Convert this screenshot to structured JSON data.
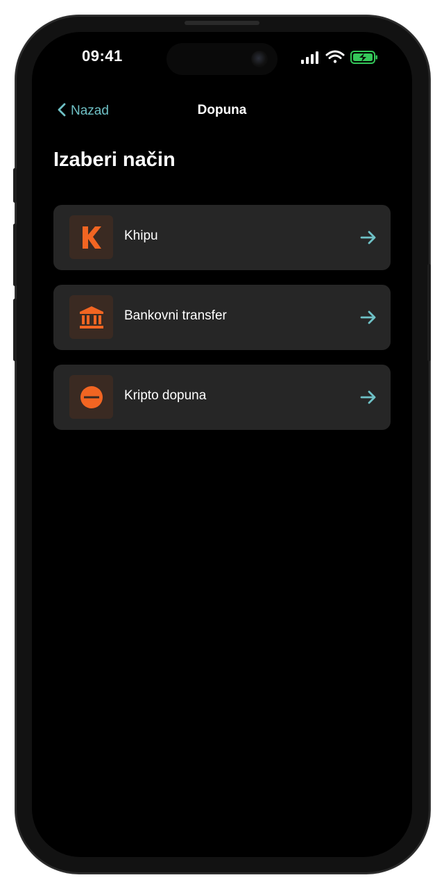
{
  "status_bar": {
    "time": "09:41",
    "signal_icon": "cellular-signal-icon",
    "wifi_icon": "wifi-icon",
    "battery_icon": "battery-charging-icon"
  },
  "nav": {
    "back_label": "Nazad",
    "back_icon": "chevron-left-icon",
    "title": "Dopuna"
  },
  "page": {
    "title": "Izaberi način"
  },
  "options": [
    {
      "label": "Khipu",
      "icon": "khipu-logo-icon",
      "arrow_icon": "arrow-right-icon"
    },
    {
      "label": "Bankovni transfer",
      "icon": "bank-icon",
      "arrow_icon": "arrow-right-icon"
    },
    {
      "label": "Kripto dopuna",
      "icon": "crypto-coin-icon",
      "arrow_icon": "arrow-right-icon"
    }
  ],
  "colors": {
    "accent": "#6fc1c6",
    "brand_orange": "#f26522",
    "card_bg": "#262626",
    "icon_bg": "#3a2a22",
    "battery_green": "#34c759"
  }
}
